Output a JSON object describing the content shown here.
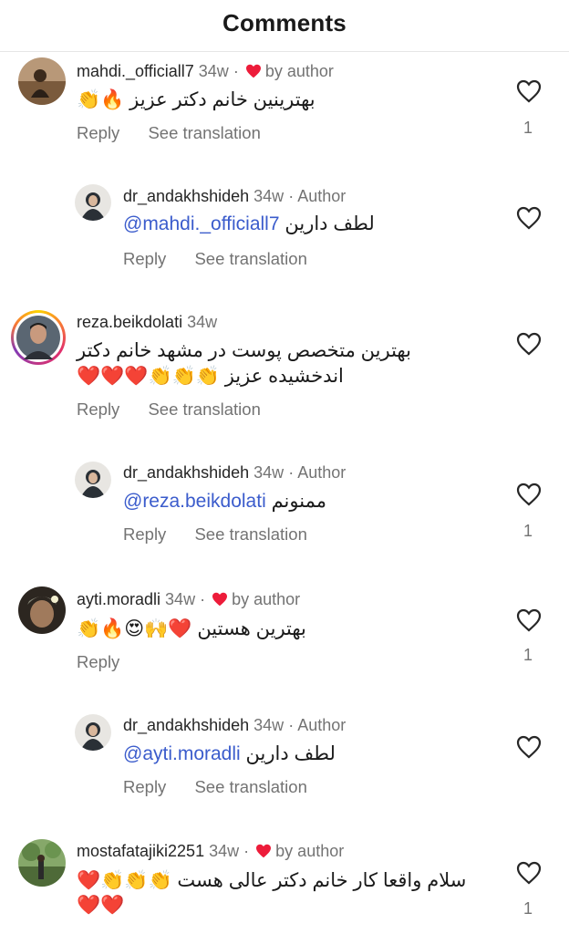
{
  "header": {
    "title": "Comments"
  },
  "labels": {
    "reply": "Reply",
    "see_translation": "See translation",
    "by_author": "by author",
    "author": "Author",
    "dot": "·"
  },
  "comments": [
    {
      "username": "mahdi._officiall7",
      "time": "34w",
      "text": "بهترینین خانم دکتر عزیز 🔥👏",
      "likes": "1",
      "liked_by_author": true,
      "avatar_color": "#8a6b4a"
    },
    {
      "username": "dr_andakhshideh",
      "time": "34w",
      "mention": "@mahdi._officiall7",
      "text": "لطف دارین",
      "is_author": true,
      "avatar_color": "#2f3a40"
    },
    {
      "username": "reza.beikdolati",
      "time": "34w",
      "text_line1": "بهترین متخصص پوست در مشهد خانم دکتر",
      "text_line2": "اندخشیده عزیز 👏👏👏❤️❤️❤️",
      "has_story_ring": true,
      "avatar_color": "#4a5560"
    },
    {
      "username": "dr_andakhshideh",
      "time": "34w",
      "mention": "@reza.beikdolati",
      "text": "ممنونم",
      "likes": "1",
      "is_author": true,
      "avatar_color": "#2f3a40"
    },
    {
      "username": "ayti.moradli",
      "time": "34w",
      "text": "بهترین هستین ❤️🙌😍🔥👏",
      "likes": "1",
      "liked_by_author": true,
      "avatar_color": "#3a3028"
    },
    {
      "username": "dr_andakhshideh",
      "time": "34w",
      "mention": "@ayti.moradli",
      "text": "لطف دارین",
      "is_author": true,
      "avatar_color": "#2f3a40"
    },
    {
      "username": "mostafatajiki2251",
      "time": "34w",
      "text_line1": "سلام واقعا کار خانم دکتر عالی هست 👏👏👏❤️",
      "text_line2": "❤️❤️",
      "likes": "1",
      "liked_by_author": true,
      "avatar_color": "#5d7a48"
    }
  ],
  "colors": {
    "heart_red": "#ed1c3a",
    "mention_blue": "#3b5ccc",
    "secondary_text": "#737373"
  }
}
